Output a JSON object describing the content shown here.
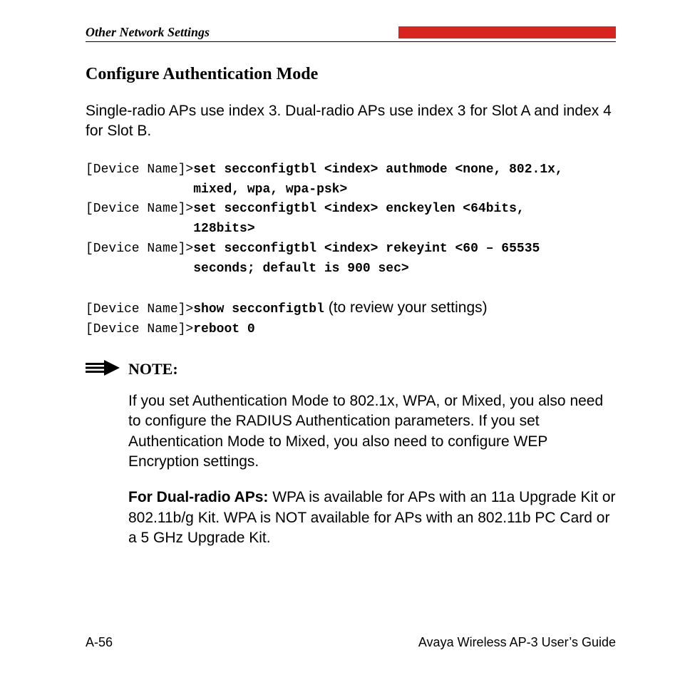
{
  "header": {
    "section": "Other Network Settings"
  },
  "title": "Configure Authentication Mode",
  "intro": "Single-radio APs use index 3. Dual-radio APs use index 3 for Slot A and index 4 for Slot B.",
  "cmd1": {
    "p1": "[Device Name]>",
    "b1": "set secconfigtbl <index> authmode <none, 802.1x,",
    "b1b": "mixed, wpa, wpa-psk>",
    "p2": "[Device Name]>",
    "b2": "set secconfigtbl <index> enckeylen <64bits,",
    "b2b": "128bits>",
    "p3": "[Device Name]>",
    "b3": "set secconfigtbl <index> rekeyint <60 – 65535",
    "b3b": "seconds; default is 900 sec>"
  },
  "cmd2": {
    "p1": "[Device Name]>",
    "b1": "show secconfigtbl",
    "a1": " (to review your settings)",
    "p2": "[Device Name]>",
    "b2": "reboot 0"
  },
  "note": {
    "label": "NOTE:",
    "body1": "If you set Authentication Mode to 802.1x, WPA, or Mixed, you also need to configure the RADIUS Authentication parameters. If you set Authentication Mode to Mixed, you also need to configure WEP Encryption settings.",
    "body2_bold": "For Dual-radio APs:",
    "body2_rest": " WPA is available for APs with an 11a Upgrade Kit or 802.11b/g Kit. WPA is NOT available for APs with an 802.11b PC Card or a 5 GHz Upgrade Kit."
  },
  "footer": {
    "left": "A-56",
    "right": "Avaya Wireless AP-3 User’s Guide"
  }
}
